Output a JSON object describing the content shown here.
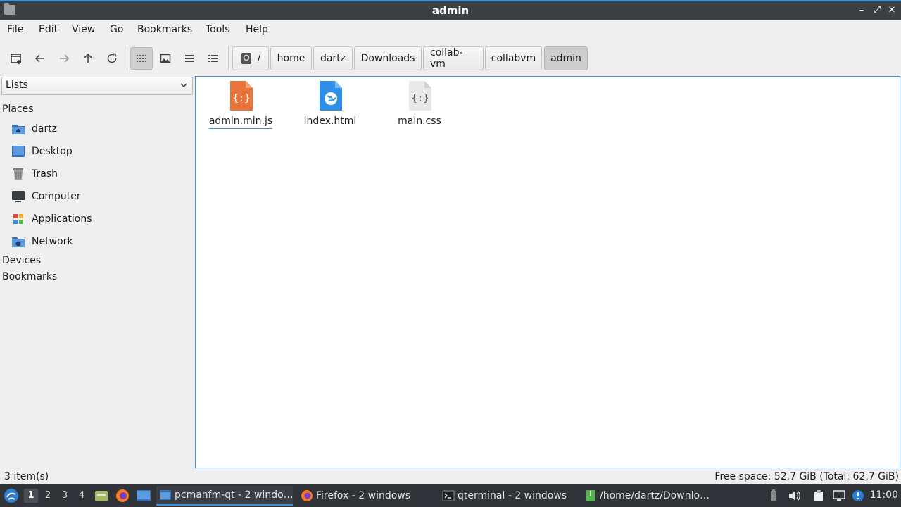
{
  "window": {
    "title": "admin",
    "minimize": "–",
    "maximize": "⤢",
    "close": "✕"
  },
  "menu": [
    "File",
    "Edit",
    "View",
    "Go",
    "Bookmarks",
    "Tools",
    "Help"
  ],
  "breadcrumb": {
    "root": "/",
    "segments": [
      "home",
      "dartz",
      "Downloads",
      "collab-vm",
      "collabvm",
      "admin"
    ]
  },
  "sidepane": {
    "mode": "Lists",
    "places_header": "Places",
    "places": [
      "dartz",
      "Desktop",
      "Trash",
      "Computer",
      "Applications",
      "Network"
    ],
    "devices_header": "Devices",
    "bookmarks_header": "Bookmarks"
  },
  "files": [
    {
      "name": "admin.min.js",
      "type": "js"
    },
    {
      "name": "index.html",
      "type": "html"
    },
    {
      "name": "main.css",
      "type": "css"
    }
  ],
  "status": {
    "count": "3 item(s)",
    "free_space": "Free space: 52.7 GiB (Total: 62.7 GiB)"
  },
  "taskbar": {
    "desktops": [
      "1",
      "2",
      "3",
      "4"
    ],
    "active_desktop": "1",
    "tasks": [
      {
        "label": "pcmanfm-qt - 2 windo…",
        "icon": "folder-icon"
      },
      {
        "label": "Firefox - 2 windows",
        "icon": "firefox-icon"
      },
      {
        "label": "qterminal - 2 windows",
        "icon": "terminal-icon"
      },
      {
        "label": "/home/dartz/Downlo…",
        "icon": "archive-icon"
      }
    ],
    "clock": "11:00"
  },
  "colors": {
    "accent": "#3d8fd6",
    "js_icon": "#e8743b",
    "html_icon": "#2f8fe8",
    "css_icon": "#e6e6e6",
    "taskbar": "#303338"
  }
}
